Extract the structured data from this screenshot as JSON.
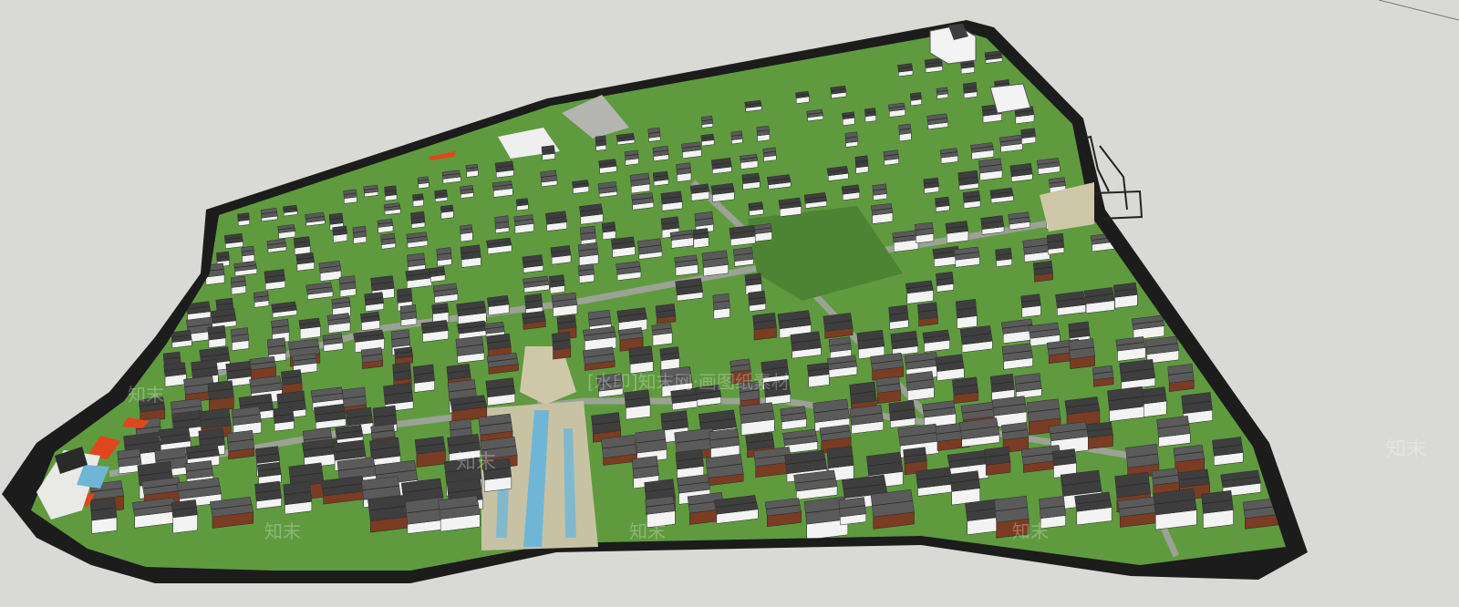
{
  "scene": {
    "subject": "3d-town-model",
    "colors": {
      "background": "#d9d9d6",
      "base_edge": "#1c1c1c",
      "lawn": "#5f9a3f",
      "lawn_dark": "#4d8433",
      "roof": "#5a5a5a",
      "roof_dark": "#3e3e3e",
      "wall": "#f3f3f3",
      "brick": "#7a3c22",
      "water": "#6fb6d6",
      "plaza": "#cfc8a8",
      "road": "#9a9a96",
      "accent": "#e2461c"
    }
  },
  "watermark": {
    "brand": "知末",
    "caption": "[水印]知末网·画图纸素材"
  }
}
